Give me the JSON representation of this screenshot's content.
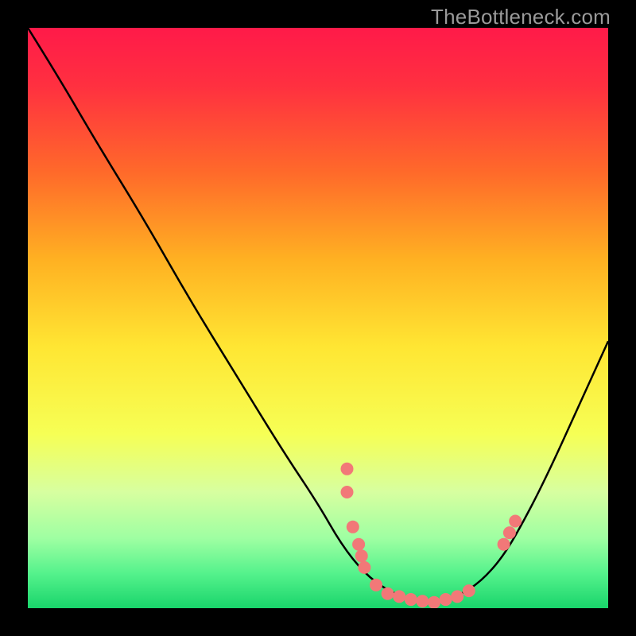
{
  "watermark": "TheBottleneck.com",
  "chart_data": {
    "type": "line",
    "title": "",
    "xlabel": "",
    "ylabel": "",
    "xlim": [
      0,
      100
    ],
    "ylim": [
      0,
      100
    ],
    "background_gradient": {
      "stops": [
        {
          "offset": 0.0,
          "color": "#ff1a49"
        },
        {
          "offset": 0.1,
          "color": "#ff3040"
        },
        {
          "offset": 0.25,
          "color": "#ff6a2a"
        },
        {
          "offset": 0.4,
          "color": "#ffb122"
        },
        {
          "offset": 0.55,
          "color": "#ffe633"
        },
        {
          "offset": 0.7,
          "color": "#f6ff55"
        },
        {
          "offset": 0.8,
          "color": "#d7ffa0"
        },
        {
          "offset": 0.88,
          "color": "#9effa2"
        },
        {
          "offset": 0.94,
          "color": "#55f28c"
        },
        {
          "offset": 1.0,
          "color": "#19d56b"
        }
      ]
    },
    "curve": [
      {
        "x": 0,
        "y": 100
      },
      {
        "x": 5,
        "y": 92
      },
      {
        "x": 12,
        "y": 80
      },
      {
        "x": 20,
        "y": 67
      },
      {
        "x": 28,
        "y": 53
      },
      {
        "x": 36,
        "y": 40
      },
      {
        "x": 44,
        "y": 27
      },
      {
        "x": 50,
        "y": 18
      },
      {
        "x": 54,
        "y": 11
      },
      {
        "x": 58,
        "y": 6
      },
      {
        "x": 62,
        "y": 3
      },
      {
        "x": 66,
        "y": 1.5
      },
      {
        "x": 70,
        "y": 1
      },
      {
        "x": 74,
        "y": 2
      },
      {
        "x": 78,
        "y": 4.5
      },
      {
        "x": 82,
        "y": 9
      },
      {
        "x": 86,
        "y": 16
      },
      {
        "x": 90,
        "y": 24
      },
      {
        "x": 95,
        "y": 35
      },
      {
        "x": 100,
        "y": 46
      }
    ],
    "markers": [
      {
        "x": 55,
        "y": 24
      },
      {
        "x": 55,
        "y": 20
      },
      {
        "x": 56,
        "y": 14
      },
      {
        "x": 57,
        "y": 11
      },
      {
        "x": 57.5,
        "y": 9
      },
      {
        "x": 58,
        "y": 7
      },
      {
        "x": 60,
        "y": 4
      },
      {
        "x": 62,
        "y": 2.5
      },
      {
        "x": 64,
        "y": 2
      },
      {
        "x": 66,
        "y": 1.5
      },
      {
        "x": 68,
        "y": 1.2
      },
      {
        "x": 70,
        "y": 1
      },
      {
        "x": 72,
        "y": 1.5
      },
      {
        "x": 74,
        "y": 2
      },
      {
        "x": 76,
        "y": 3
      },
      {
        "x": 82,
        "y": 11
      },
      {
        "x": 83,
        "y": 13
      },
      {
        "x": 84,
        "y": 15
      }
    ],
    "marker_style": {
      "fill": "#f27878",
      "r": 8
    }
  }
}
